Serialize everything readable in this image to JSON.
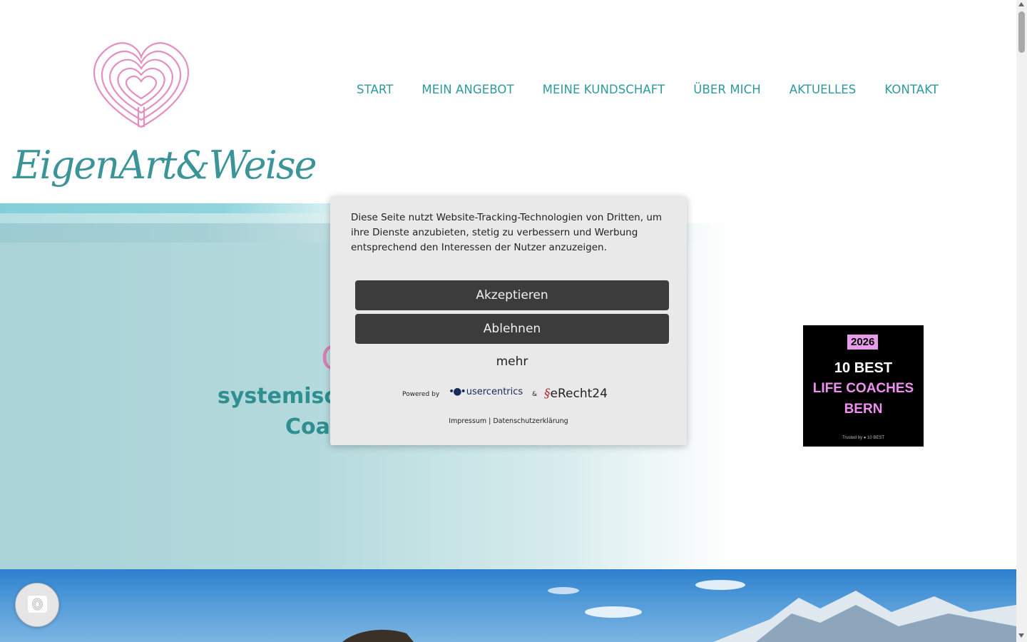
{
  "logo": {
    "text": "EigenArt&Weise",
    "heart_color": "#e48ec1",
    "text_color": "#3a9498"
  },
  "nav": {
    "items": [
      "START",
      "MEIN ANGEBOT",
      "MEINE KUNDSCHAFT",
      "ÜBER MICH",
      "AKTUELLES",
      "KONTAKT"
    ],
    "color": "#2e9a9b"
  },
  "hero": {
    "glyph": "C",
    "title_line1": "systemisch",
    "title_line2": "Coac"
  },
  "badge": {
    "year": "2026",
    "line1": "10 BEST",
    "line2": "LIFE COACHES",
    "line3": "BERN",
    "trust": "Trusted by ● 10 BEST"
  },
  "cookie": {
    "text": "Diese Seite nutzt Website-Tracking-Technologien von Dritten, um ihre Dienste anzubieten, stetig zu verbessern und Werbung entsprechend den Interessen der Nutzer anzuzeigen.",
    "accept_label": "Akzeptieren",
    "decline_label": "Ablehnen",
    "more_label": "mehr",
    "powered_by": "Powered by",
    "usercentrics": "usercentrics",
    "amp": "&",
    "erecht": "eRecht24",
    "legal": "Impressum | Datenschutzerklärung"
  },
  "colors": {
    "accent": "#2e9a9b",
    "button_bg": "#3c3c3c",
    "modal_bg": "#e9e9e9"
  }
}
